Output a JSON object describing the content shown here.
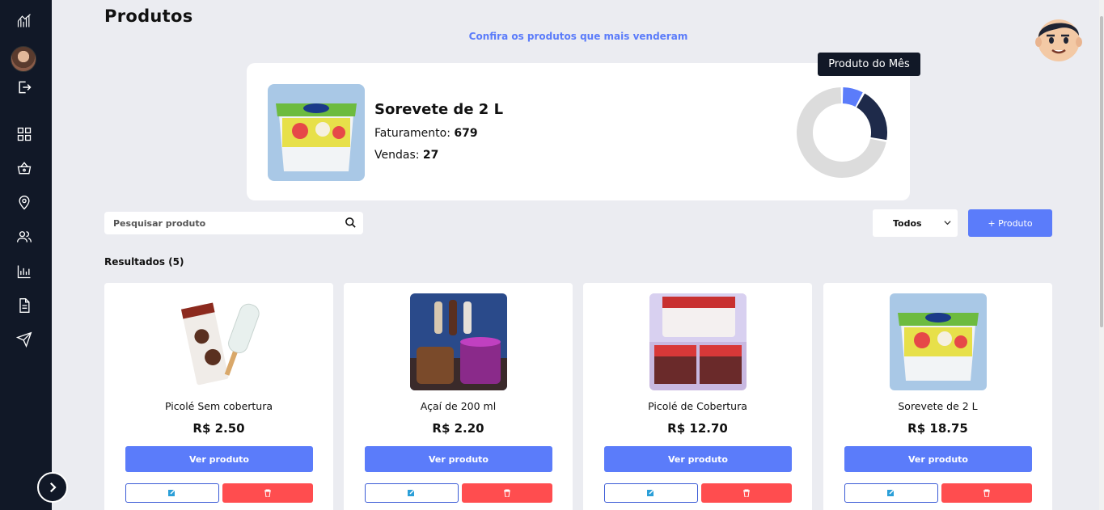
{
  "sidebar": {
    "items": [
      {
        "name": "logo-icon"
      },
      {
        "name": "logout-icon"
      },
      {
        "name": "dashboard-icon"
      },
      {
        "name": "basket-icon"
      },
      {
        "name": "location-icon"
      },
      {
        "name": "users-icon"
      },
      {
        "name": "chart-icon"
      },
      {
        "name": "document-icon"
      },
      {
        "name": "send-icon"
      }
    ]
  },
  "header": {
    "title": "Produtos",
    "subtitle": "Confira os produtos que mais venderam"
  },
  "highlight": {
    "name": "Sorevete de 2 L",
    "faturamento_label": "Faturamento:",
    "faturamento_value": "679",
    "vendas_label": "Vendas:",
    "vendas_value": "27",
    "tooltip": "Produto do Mês",
    "donut": [
      {
        "label": "segment-1",
        "value": 0.08,
        "color": "#5b7cfa"
      },
      {
        "label": "segment-2",
        "value": 0.2,
        "color": "#1e2a4a"
      },
      {
        "label": "segment-3",
        "value": 0.72,
        "color": "#dcdcdc"
      }
    ]
  },
  "controls": {
    "search_placeholder": "Pesquisar produto",
    "filter_value": "Todos",
    "add_label": "+ Produto"
  },
  "results_label": "Resultados (5)",
  "products": [
    {
      "name": "Picolé Sem cobertura",
      "price": "R$ 2.50",
      "view_label": "Ver produto"
    },
    {
      "name": "Açaí de 200 ml",
      "price": "R$ 2.20",
      "view_label": "Ver produto"
    },
    {
      "name": "Picolé de Cobertura",
      "price": "R$ 12.70",
      "view_label": "Ver produto"
    },
    {
      "name": "Sorevete de 2 L",
      "price": "R$ 18.75",
      "view_label": "Ver produto"
    }
  ],
  "colors": {
    "sidebar": "#111827",
    "accent": "#5b7cfa",
    "danger": "#ff4d4f",
    "background": "#ebecf1"
  }
}
